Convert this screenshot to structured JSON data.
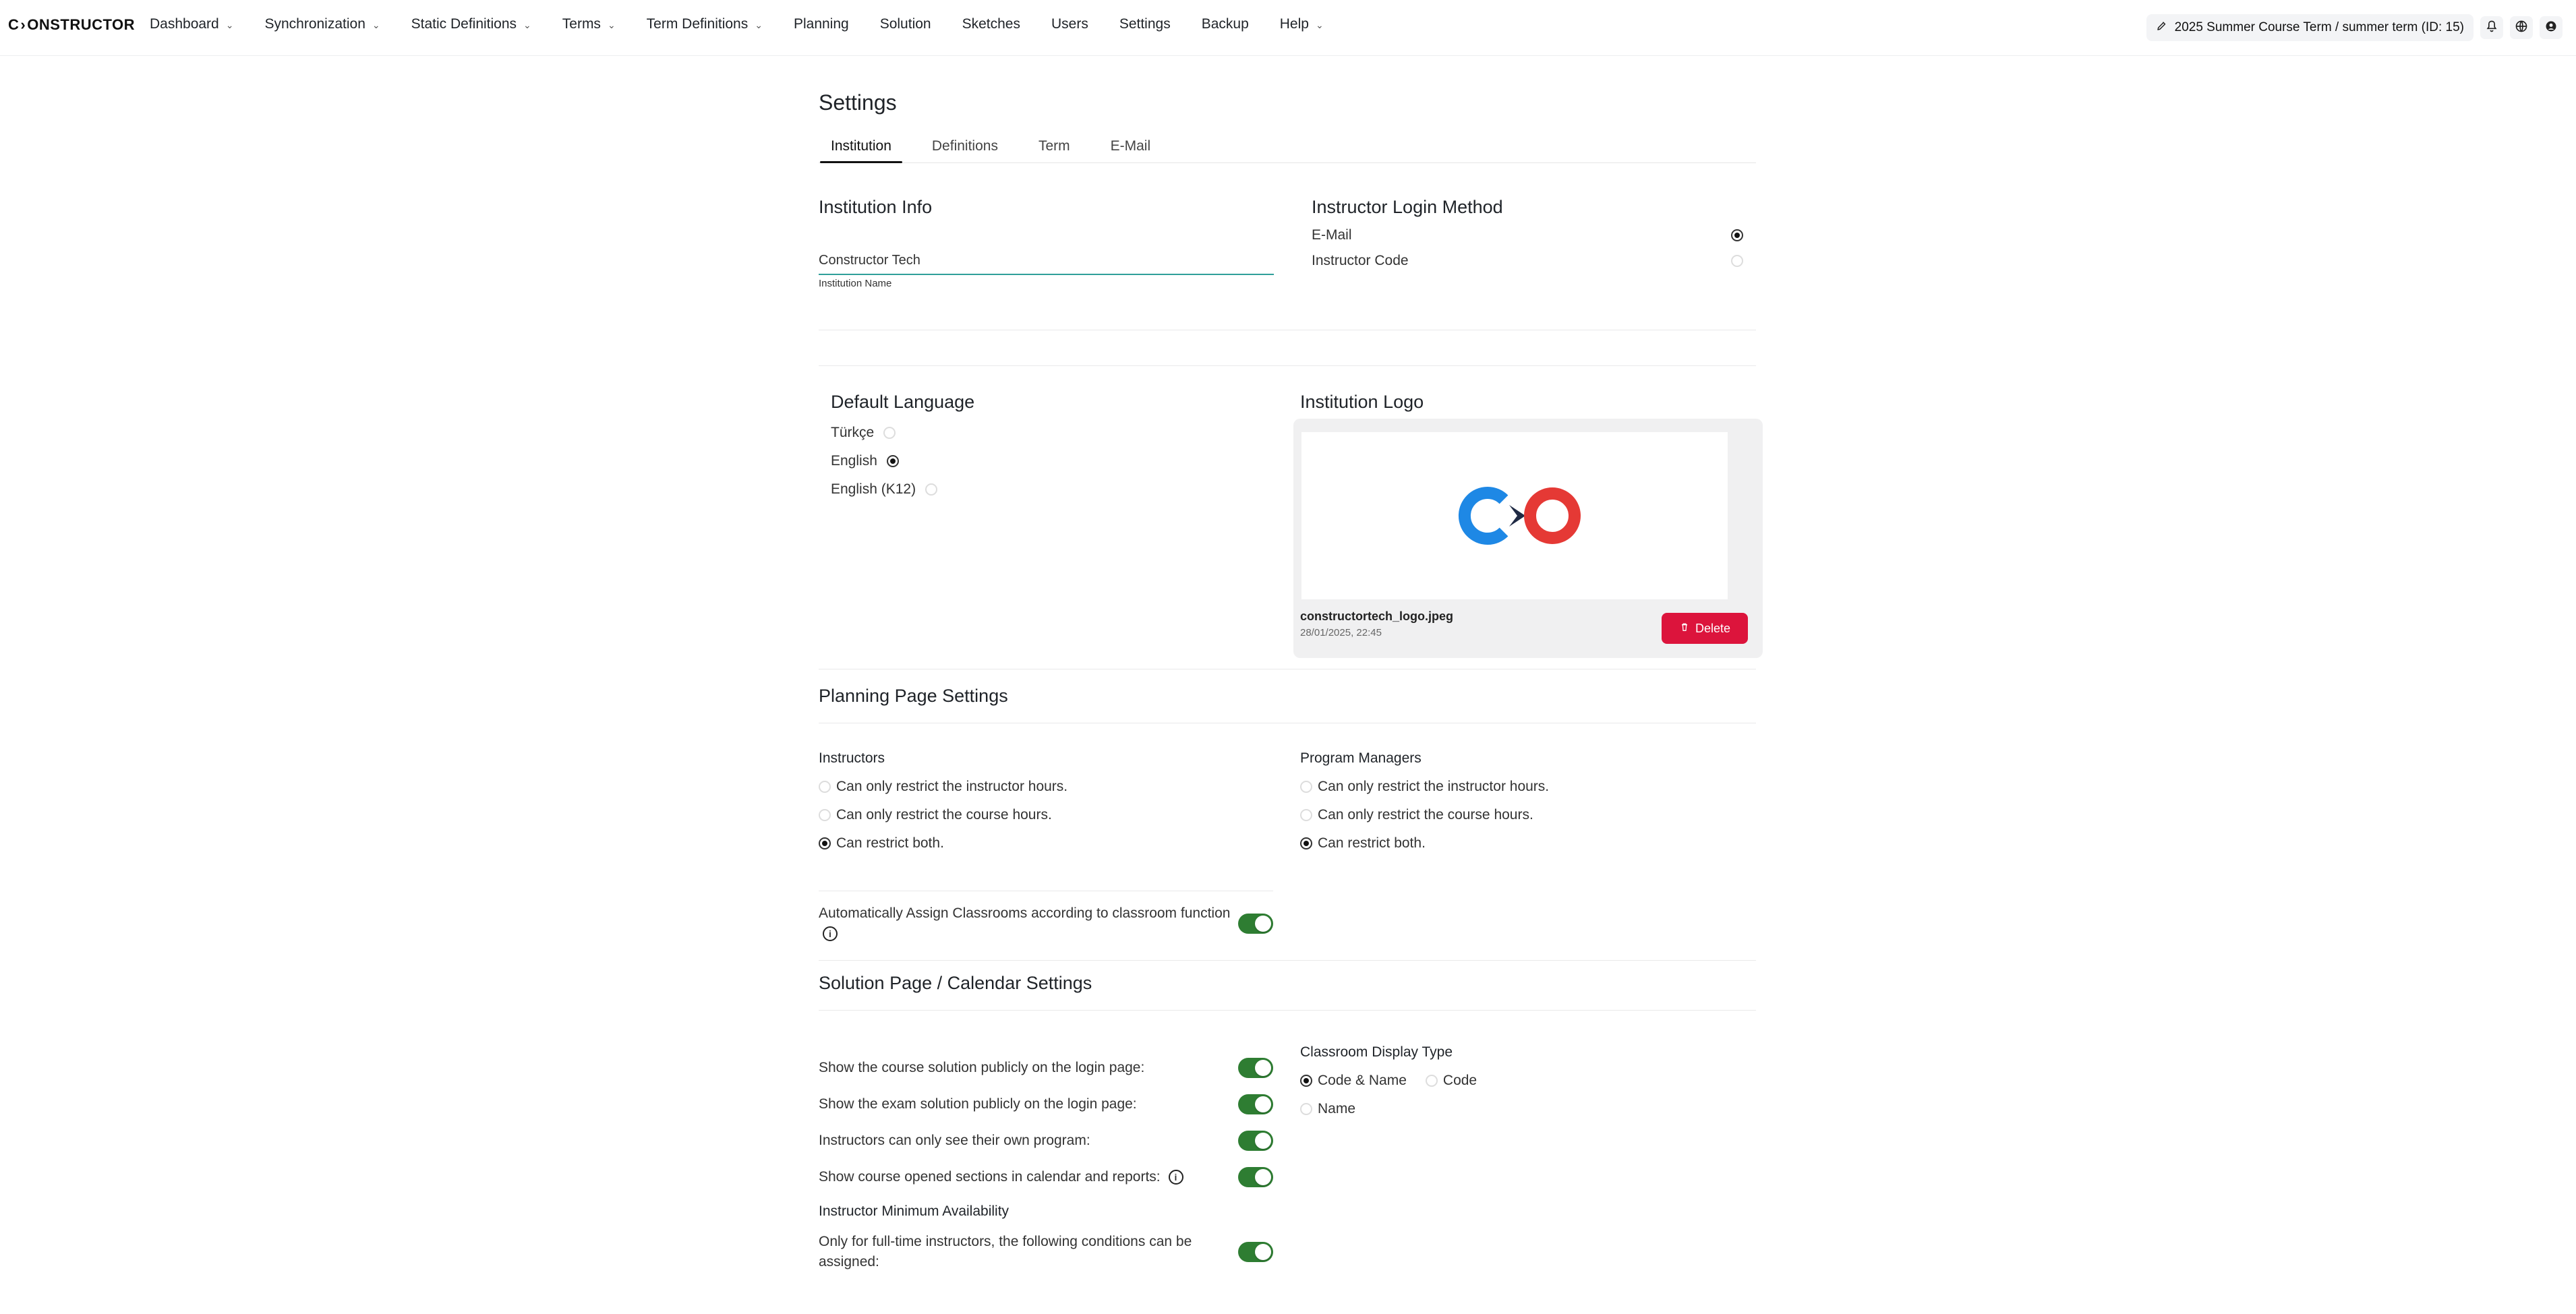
{
  "brand": {
    "name_prefix": "C",
    "name_suffix": "ONSTRUCTOR",
    "arrow": "›"
  },
  "nav": {
    "items": [
      {
        "label": "Dashboard",
        "has_caret": true
      },
      {
        "label": "Synchronization",
        "has_caret": true
      },
      {
        "label": "Static Definitions",
        "has_caret": true
      },
      {
        "label": "Terms",
        "has_caret": true
      },
      {
        "label": "Term Definitions",
        "has_caret": true
      },
      {
        "label": "Planning",
        "has_caret": false
      },
      {
        "label": "Solution",
        "has_caret": false
      },
      {
        "label": "Sketches",
        "has_caret": false
      },
      {
        "label": "Users",
        "has_caret": false
      },
      {
        "label": "Settings",
        "has_caret": false
      },
      {
        "label": "Backup",
        "has_caret": false
      },
      {
        "label": "Help",
        "has_caret": true
      }
    ],
    "caret_symbol": "⌄"
  },
  "topright": {
    "term_label": "2025 Summer Course Term / summer term (ID: 15)",
    "icons": [
      "edit-icon",
      "bell-icon",
      "globe-icon",
      "user-icon"
    ]
  },
  "page": {
    "title": "Settings",
    "tabs": [
      "Institution",
      "Definitions",
      "Term",
      "E-Mail"
    ]
  },
  "institution_info": {
    "heading": "Institution Info",
    "name_value": "Constructor Tech",
    "name_label": "Institution Name"
  },
  "login_method": {
    "heading": "Instructor Login Method",
    "options": [
      "E-Mail",
      "Instructor Code"
    ],
    "selected_index": 0
  },
  "default_language": {
    "heading": "Default Language",
    "options": [
      "Türkçe",
      "English",
      "English (K12)"
    ],
    "selected_index": 1
  },
  "institution_logo": {
    "heading": "Institution Logo",
    "file_name": "constructortech_logo.jpeg",
    "file_date": "28/01/2025, 22:45",
    "delete_label": "Delete",
    "colors": {
      "blue": "#1e88e5",
      "navy": "#1f2a44",
      "red": "#e53935"
    }
  },
  "planning": {
    "heading": "Planning Page Settings",
    "instructors_heading": "Instructors",
    "program_managers_heading": "Program Managers",
    "options": [
      "Can only restrict the instructor hours.",
      "Can only restrict the course hours.",
      "Can restrict both."
    ],
    "instructors_selected_index": 2,
    "program_managers_selected_index": 2,
    "auto_assign_label": "Automatically Assign Classrooms according to classroom function",
    "auto_assign_enabled": true
  },
  "solution": {
    "heading": "Solution Page / Calendar Settings",
    "toggles": [
      {
        "label": "Show the course solution publicly on the login page:",
        "enabled": true
      },
      {
        "label": "Show the exam solution publicly on the login page:",
        "enabled": true
      },
      {
        "label": "Instructors can only see their own program:",
        "enabled": true
      },
      {
        "label": "Show course opened sections in calendar and reports:",
        "enabled": true,
        "info": true
      }
    ],
    "instructor_min_availability_heading": "Instructor Minimum Availability",
    "fulltime_label": "Only for full-time instructors, the following conditions can be assigned:",
    "fulltime_enabled": true,
    "classroom_display": {
      "heading": "Classroom Display Type",
      "options": [
        "Code & Name",
        "Code",
        "Name"
      ],
      "selected_index": 0
    }
  },
  "colors": {
    "toggle_on": "#2e7d32",
    "underline": "#2f9f9a",
    "danger": "#dc143c"
  }
}
